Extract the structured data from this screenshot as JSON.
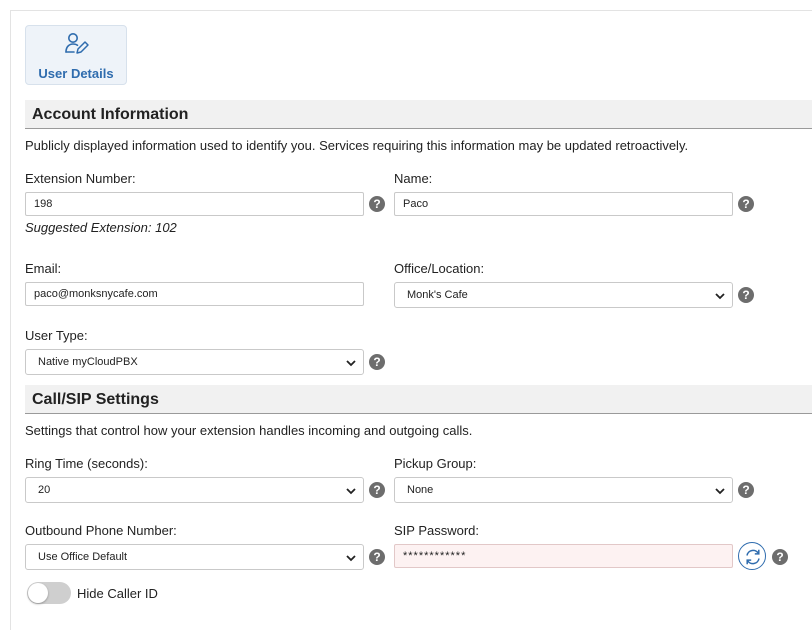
{
  "tab": {
    "label": "User Details",
    "icon": "user-edit-icon"
  },
  "account": {
    "title": "Account Information",
    "description": "Publicly displayed information used to identify you. Services requiring this information may be updated retroactively.",
    "extension_label": "Extension Number:",
    "extension_value": "198",
    "suggested": "Suggested Extension: 102",
    "name_label": "Name:",
    "name_value": "Paco",
    "email_label": "Email:",
    "email_value": "paco@monksnycafe.com",
    "office_label": "Office/Location:",
    "office_value": "Monk's Cafe",
    "user_type_label": "User Type:",
    "user_type_value": "Native myCloudPBX"
  },
  "call_sip": {
    "title": "Call/SIP Settings",
    "description": "Settings that control how your extension handles incoming and outgoing calls.",
    "ring_time_label": "Ring Time (seconds):",
    "ring_time_value": "20",
    "pickup_label": "Pickup Group:",
    "pickup_value": "None",
    "outbound_label": "Outbound Phone Number:",
    "outbound_value": "Use Office Default",
    "sip_label": "SIP Password:",
    "sip_value": "************",
    "hide_caller_label": "Hide Caller ID",
    "hide_caller_on": false
  },
  "help_glyph": "?",
  "colors": {
    "accent": "#2f6cae",
    "help": "#6d6d6d",
    "toggle_off": "#cfcfcf",
    "password_bg": "#fdf2f2"
  }
}
